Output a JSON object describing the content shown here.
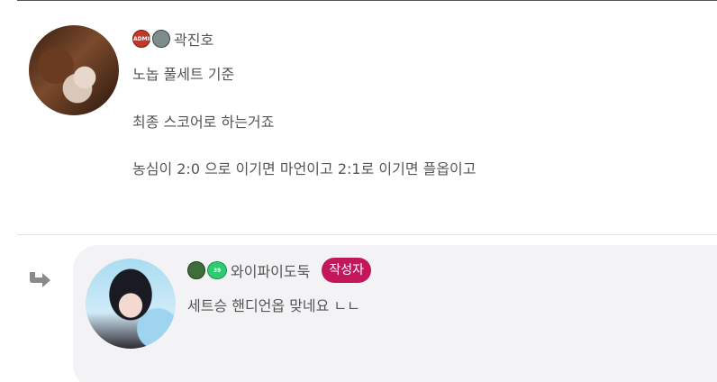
{
  "comment": {
    "author": {
      "badges": [
        "ADMIN",
        "skull-badge"
      ],
      "name": "곽진호"
    },
    "lines": [
      "노놉 풀세트 기준",
      "최종 스코어로 하는거죠",
      "농심이 2:0 으로 이기면 마언이고 2:1로 이기면 플옵이고"
    ]
  },
  "reply": {
    "author": {
      "badges": [
        "green-badge",
        "39"
      ],
      "name": "와이파이도둑",
      "writer_tag": "작성자"
    },
    "text": "세트승 핸디언옵 맞네요 ㄴㄴ"
  },
  "colors": {
    "writer_tag": "#c2185b",
    "reply_background": "#f3f3f5",
    "text": "#555555"
  }
}
